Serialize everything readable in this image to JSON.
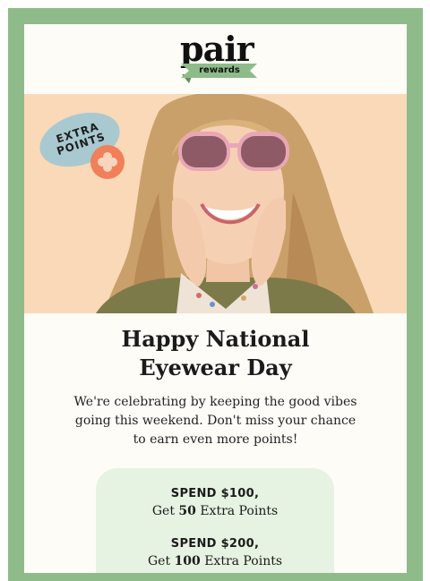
{
  "brand": {
    "logo_word": "pair",
    "logo_ribbon": "rewards",
    "colors": {
      "frame": "#8fbb8b",
      "card": "#fdfcf7",
      "hero_bg": "#f9d9b8",
      "badge": "#a9c9d1",
      "flower_badge": "#f07f5a",
      "offer_bg": "#e6f2e2"
    }
  },
  "hero": {
    "badge_line1": "EXTRA",
    "badge_line2": "POINTS",
    "flower_icon": "flower-icon"
  },
  "headline": {
    "line1": "Happy National",
    "line2": "Eyewear Day"
  },
  "intro": {
    "line1": "We're celebrating by keeping the good vibes",
    "line2": "going this weekend. Don't miss your chance",
    "line3": "to earn even more points!"
  },
  "offers": [
    {
      "title": "SPEND $100,",
      "desc_pre": "Get ",
      "points": "50",
      "desc_post": " Extra Points"
    },
    {
      "title": "SPEND $200,",
      "desc_pre": "Get ",
      "points": "100",
      "desc_post": " Extra Points"
    }
  ]
}
